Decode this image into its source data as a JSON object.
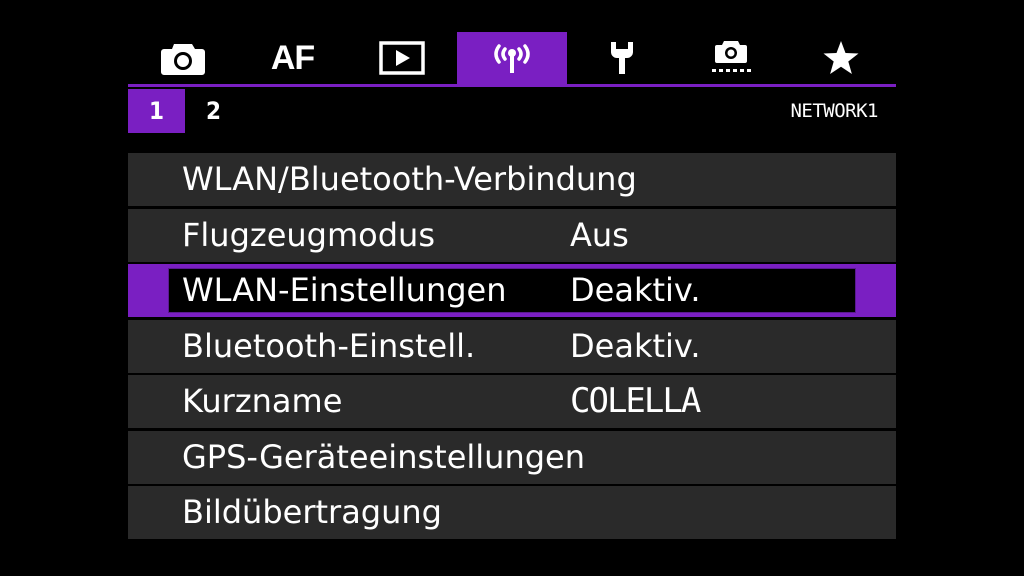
{
  "tabs": [
    {
      "name": "shooting",
      "icon": "camera-icon",
      "active": false
    },
    {
      "name": "af",
      "label": "AF",
      "active": false
    },
    {
      "name": "playback",
      "icon": "play-icon",
      "active": false
    },
    {
      "name": "wireless",
      "icon": "wireless-icon",
      "active": true
    },
    {
      "name": "setup",
      "icon": "wrench-icon",
      "active": false
    },
    {
      "name": "custom",
      "icon": "custom-camera-icon",
      "active": false
    },
    {
      "name": "my-menu",
      "icon": "star-icon",
      "active": false
    }
  ],
  "subpages": {
    "items": [
      "1",
      "2"
    ],
    "active_index": 0,
    "page_label": "NETWORK1"
  },
  "menu": {
    "items": [
      {
        "label": "WLAN/Bluetooth-Verbindung",
        "value": ""
      },
      {
        "label": "Flugzeugmodus",
        "value": "Aus"
      },
      {
        "label": "WLAN-Einstellungen",
        "value": "Deaktiv."
      },
      {
        "label": "Bluetooth-Einstell.",
        "value": "Deaktiv."
      },
      {
        "label": "Kurzname",
        "value": "COLELLA"
      },
      {
        "label": "GPS-Geräteeinstellungen",
        "value": ""
      },
      {
        "label": "Bildübertragung",
        "value": ""
      }
    ],
    "selected_index": 2
  },
  "colors": {
    "accent": "#7a1fc2",
    "row_bg": "#2a2a2a",
    "background": "#000000",
    "text": "#ffffff"
  }
}
